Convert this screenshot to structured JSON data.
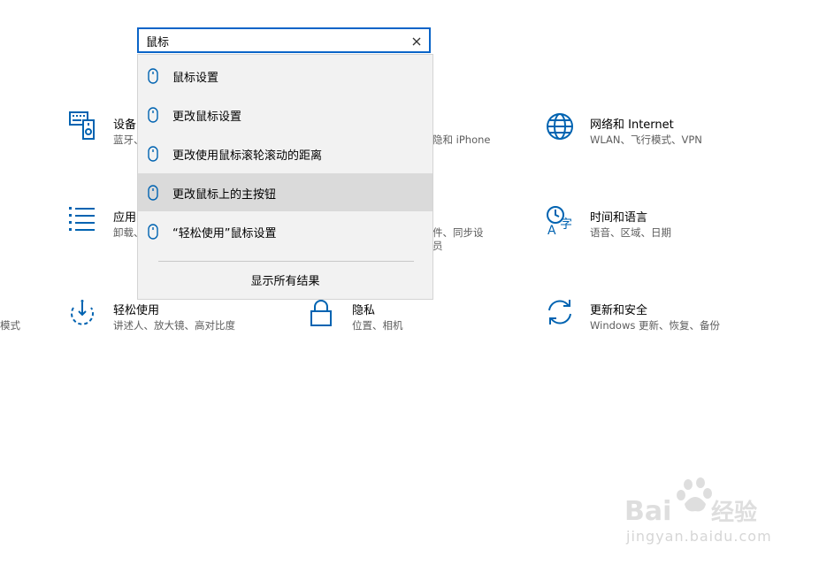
{
  "search": {
    "value": "鼠标",
    "suggestions": [
      {
        "label": "鼠标设置",
        "icon": "mouse-icon"
      },
      {
        "label": "更改鼠标设置",
        "icon": "mouse-icon"
      },
      {
        "label": "更改使用鼠标滚轮滚动的距离",
        "icon": "mouse-icon"
      },
      {
        "label": "更改鼠标上的主按钮",
        "icon": "mouse-icon",
        "highlighted": true
      },
      {
        "label": "“轻松使用”鼠标设置",
        "icon": "mouse-icon"
      }
    ],
    "show_all": "显示所有结果"
  },
  "categories": {
    "devices": {
      "title": "设备",
      "subtitle": "蓝牙、",
      "icon": "devices-icon"
    },
    "phone": {
      "subtitle": "隐和 iPhone"
    },
    "network": {
      "title": "网络和 Internet",
      "subtitle": "WLAN、飞行模式、VPN",
      "icon": "globe-icon"
    },
    "apps": {
      "title": "应用",
      "subtitle": "卸载、",
      "icon": "apps-list-icon"
    },
    "accounts": {
      "subtitle_line1": "件、同步设",
      "subtitle_line2": "员"
    },
    "time_language": {
      "title": "时间和语言",
      "subtitle": "语音、区域、日期",
      "icon": "time-language-icon"
    },
    "gaming_partial": {
      "subtitle": "模式"
    },
    "ease_of_access": {
      "title": "轻松使用",
      "subtitle": "讲述人、放大镜、高对比度",
      "icon": "ease-of-access-icon"
    },
    "privacy": {
      "title": "隐私",
      "subtitle": "位置、相机",
      "icon": "lock-icon"
    },
    "update_security": {
      "title": "更新和安全",
      "subtitle": "Windows 更新、恢复、备份",
      "icon": "sync-icon"
    }
  },
  "watermark": {
    "logo": "Baidu 经验",
    "url": "jingyan.baidu.com"
  },
  "colors": {
    "accent": "#0a64c8",
    "icon_blue": "#0063b1",
    "highlight": "#dadada",
    "dropdown_bg": "#f2f2f2"
  }
}
